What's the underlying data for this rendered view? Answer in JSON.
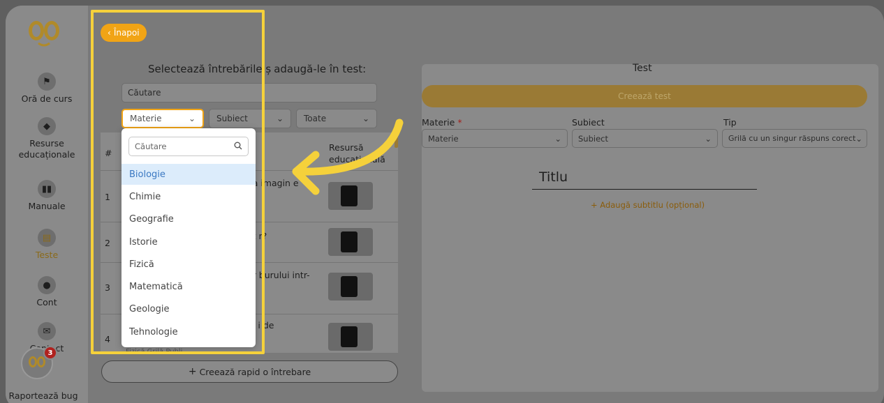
{
  "sidebar": {
    "logo": "logo-icon",
    "items": [
      {
        "label": "Oră de curs",
        "icon": "teacher-icon"
      },
      {
        "label": "Resurse educaționale",
        "icon": "cube-icon"
      },
      {
        "label": "Manuale",
        "icon": "book-icon"
      },
      {
        "label": "Teste",
        "icon": "file-icon",
        "active": true
      },
      {
        "label": "Cont",
        "icon": "user-icon"
      },
      {
        "label": "Contact",
        "icon": "envelope-icon"
      }
    ],
    "bug": {
      "label": "Raportează bug",
      "badge": "3"
    }
  },
  "left": {
    "back_label": "Înapoi",
    "title_part1": "Selectează întrebările ș",
    "title_part2": "adaugă-le în test:",
    "search_placeholder": "Căutare",
    "filters": {
      "materie": "Materie",
      "subiect": "Subiect",
      "toate": "Toate"
    },
    "table": {
      "col_num": "#",
      "col_resource_line1": "Resursă",
      "col_resource_line2": "educațională",
      "rows": [
        {
          "num": "1",
          "text": "ea imagin e"
        },
        {
          "num": "2",
          "text": "at r?"
        },
        {
          "num": "3",
          "text": "ar burului intr-"
        },
        {
          "num": "4",
          "text": "ul i de"
        }
      ]
    },
    "quick_create_label": "Creează rapid o întrebare",
    "partial_row_text": "Fizică Grilă Publi..."
  },
  "dropdown": {
    "search_placeholder": "Căutare",
    "options": [
      "Biologie",
      "Chimie",
      "Geografie",
      "Istorie",
      "Fizică",
      "Matematică",
      "Geologie",
      "Tehnologie"
    ],
    "highlighted": "Biologie"
  },
  "right": {
    "title": "Test",
    "create_test_label": "Creează test",
    "labels": {
      "materie": "Materie",
      "subiect": "Subiect",
      "tip": "Tip",
      "required_mark": "*"
    },
    "selects": {
      "materie": "Materie",
      "subiect": "Subiect",
      "tip": "Grilă cu un singur răspuns corect"
    },
    "heading_placeholder": "Titlu",
    "add_subtitle": "Adaugă subtitlu (opțional)"
  },
  "colors": {
    "accent": "#f1a415",
    "highlight_frame": "#f5d13b",
    "dropdown_highlight": "#dcecfb"
  }
}
